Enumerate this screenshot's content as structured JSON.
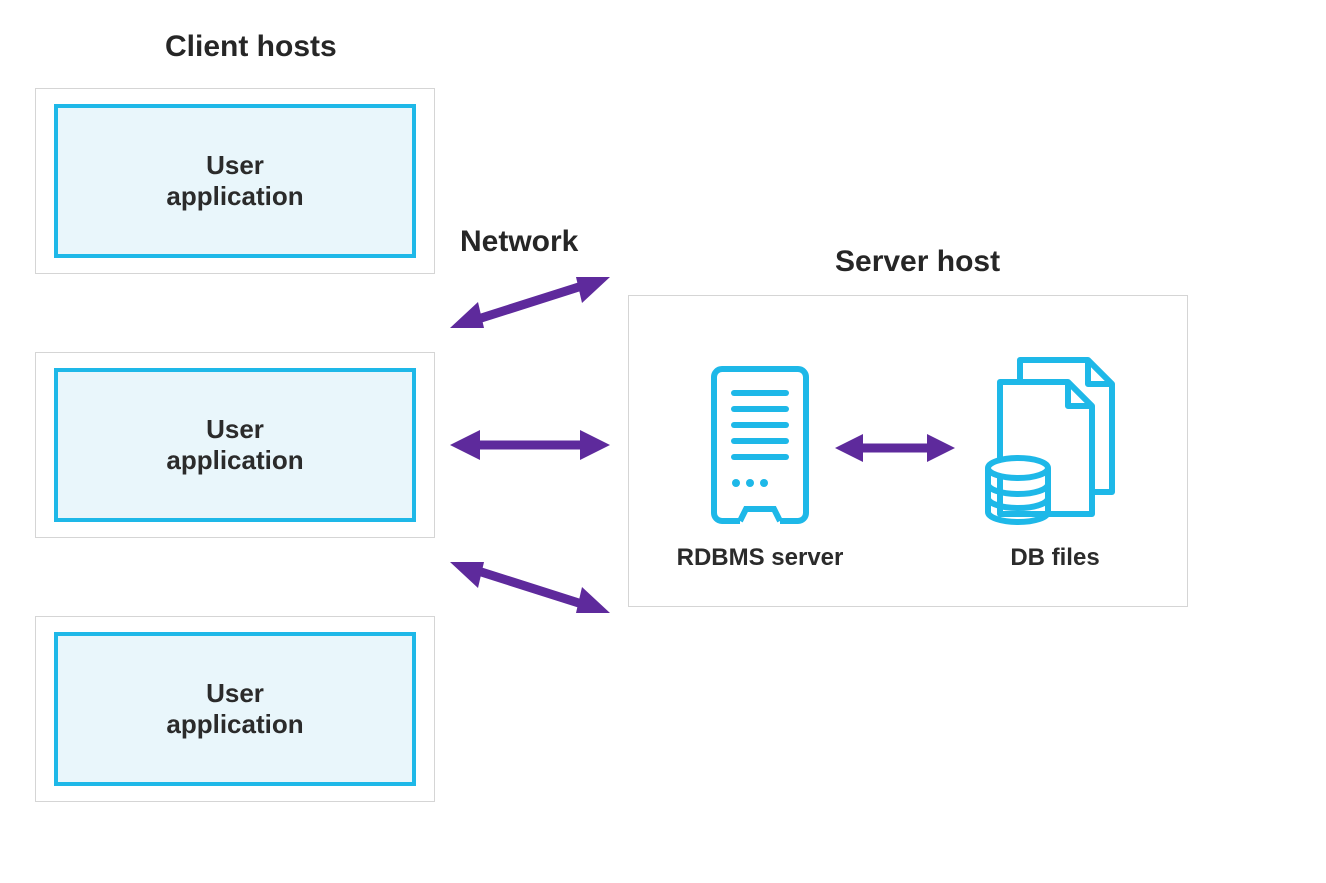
{
  "headings": {
    "client_hosts": "Client hosts",
    "network": "Network",
    "server_host": "Server host"
  },
  "clients": [
    {
      "label": "User\napplication"
    },
    {
      "label": "User\napplication"
    },
    {
      "label": "User\napplication"
    }
  ],
  "server": {
    "rdbms_label": "RDBMS server",
    "dbfiles_label": "DB files"
  },
  "colors": {
    "cyan": "#1eb8e8",
    "purple": "#5e2a9c",
    "border_gray": "#d5d5d5",
    "text": "#2b2b2b",
    "inner_fill": "#e9f6fb"
  }
}
